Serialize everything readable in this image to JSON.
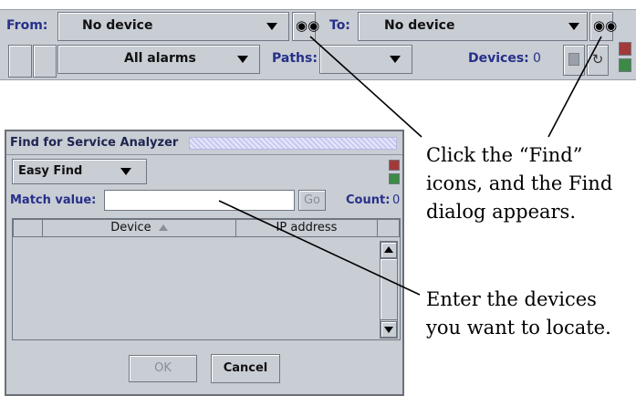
{
  "toolbar": {
    "from_label": "From:",
    "from_value": "No device",
    "to_label": "To:",
    "to_value": "No device",
    "alarms_value": "All alarms",
    "paths_label": "Paths:",
    "paths_value": "",
    "devices_label": "Devices:",
    "devices_count": "0"
  },
  "dialog": {
    "title": "Find for Service Analyzer",
    "mode_value": "Easy Find",
    "match_label": "Match value:",
    "match_value": "",
    "go_label": "Go",
    "count_label": "Count:",
    "count_value": "0",
    "columns": [
      "Device",
      "IP address"
    ],
    "ok_label": "OK",
    "cancel_label": "Cancel"
  },
  "callouts": {
    "find": "Click the “Find”\nicons, and the Find\ndialog appears.",
    "devices": "Enter the devices\nyou want to locate."
  },
  "colors": {
    "panel_bg": "#c9cdd4",
    "label_blue": "#26308a",
    "status_red": "#a23a3a",
    "status_green": "#3c8a46"
  },
  "icons": {
    "find": "binoculars-icon",
    "sort": "sort-ascending-icon"
  }
}
